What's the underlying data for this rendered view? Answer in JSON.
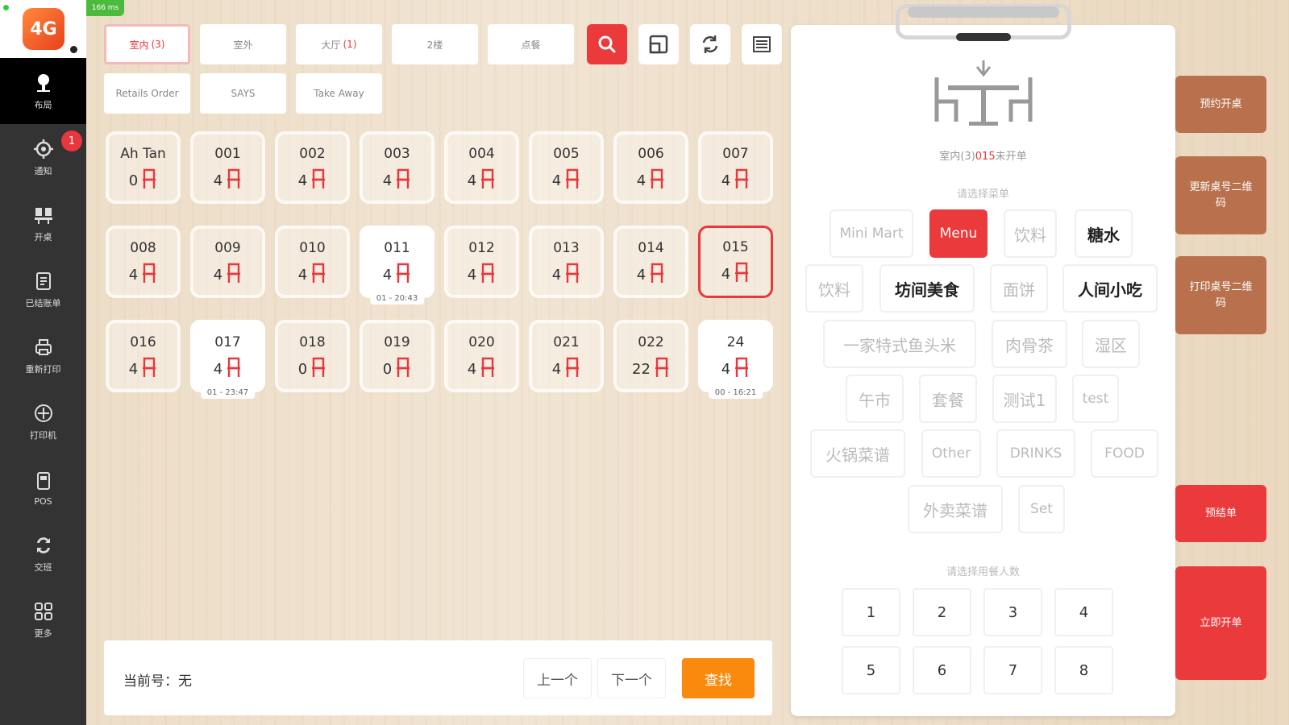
{
  "network_badge": "166 ms",
  "logo_text": "4G",
  "sidebar": {
    "items": [
      {
        "label": "布局",
        "icon": "table-layout-icon"
      },
      {
        "label": "通知",
        "icon": "bell-icon",
        "badge": "1"
      },
      {
        "label": "开桌",
        "icon": "open-table-icon"
      },
      {
        "label": "已结账单",
        "icon": "receipt-icon"
      },
      {
        "label": "重新打印",
        "icon": "reprint-icon"
      },
      {
        "label": "打印机",
        "icon": "printer-icon"
      },
      {
        "label": "POS",
        "icon": "pos-icon"
      },
      {
        "label": "交班",
        "icon": "shift-icon"
      },
      {
        "label": "更多",
        "icon": "grid-icon"
      }
    ]
  },
  "tabs": [
    {
      "label": "室内",
      "count": "(3)"
    },
    {
      "label": "室外",
      "count": ""
    },
    {
      "label": "大厅",
      "count": "(1)"
    },
    {
      "label": "2楼",
      "count": ""
    },
    {
      "label": "点餐",
      "count": ""
    },
    {
      "label": "Retails Order",
      "count": ""
    },
    {
      "label": "SAYS",
      "count": ""
    },
    {
      "label": "Take Away",
      "count": ""
    }
  ],
  "toolbar_icons": [
    "search-icon",
    "expand-icon",
    "refresh-icon",
    "list-icon"
  ],
  "tables": [
    {
      "name": "Ah Tan",
      "seats": "0"
    },
    {
      "name": "001",
      "seats": "4"
    },
    {
      "name": "002",
      "seats": "4"
    },
    {
      "name": "003",
      "seats": "4"
    },
    {
      "name": "004",
      "seats": "4"
    },
    {
      "name": "005",
      "seats": "4"
    },
    {
      "name": "006",
      "seats": "4"
    },
    {
      "name": "007",
      "seats": "4"
    },
    {
      "name": "008",
      "seats": "4"
    },
    {
      "name": "009",
      "seats": "4"
    },
    {
      "name": "010",
      "seats": "4"
    },
    {
      "name": "011",
      "seats": "4",
      "time": "01 - 20:43"
    },
    {
      "name": "012",
      "seats": "4"
    },
    {
      "name": "013",
      "seats": "4"
    },
    {
      "name": "014",
      "seats": "4"
    },
    {
      "name": "015",
      "seats": "4"
    },
    {
      "name": "016",
      "seats": "4"
    },
    {
      "name": "017",
      "seats": "4",
      "time": "01 - 23:47"
    },
    {
      "name": "018",
      "seats": "0"
    },
    {
      "name": "019",
      "seats": "0"
    },
    {
      "name": "020",
      "seats": "4"
    },
    {
      "name": "021",
      "seats": "4"
    },
    {
      "name": "022",
      "seats": "22"
    },
    {
      "name": "24",
      "seats": "4",
      "time": "00 - 16:21"
    }
  ],
  "bottom": {
    "current_label": "当前号：无",
    "prev": "上一个",
    "next": "下一个",
    "search": "查找"
  },
  "panel": {
    "table_prefix": "室内(3)",
    "table_number": "015",
    "table_suffix": "未开单",
    "menu_section": "请选择菜单",
    "menus": [
      "Mini Mart",
      "Menu",
      "饮料",
      "糖水",
      "饮料",
      "坊间美食",
      "面饼",
      "人间小吃",
      "一家特式鱼头米",
      "肉骨茶",
      "湿区",
      "午市",
      "套餐",
      "测试1",
      "test",
      "火锅菜谱",
      "Other",
      "DRINKS",
      "FOOD",
      "外卖菜谱",
      "Set"
    ],
    "people_section": "请选择用餐人数",
    "people": [
      "1",
      "2",
      "3",
      "4",
      "5",
      "6",
      "7",
      "8"
    ]
  },
  "side_buttons": [
    {
      "label": "预约开桌"
    },
    {
      "label": "更新桌号二维码"
    },
    {
      "label": "打印桌号二维码"
    },
    {
      "label": "预结单"
    },
    {
      "label": "立即开单"
    }
  ],
  "colors": {
    "accent": "#ea3a3c",
    "orange": "#f98a0e",
    "brown": "#b8714c",
    "sidebar": "#333333"
  }
}
